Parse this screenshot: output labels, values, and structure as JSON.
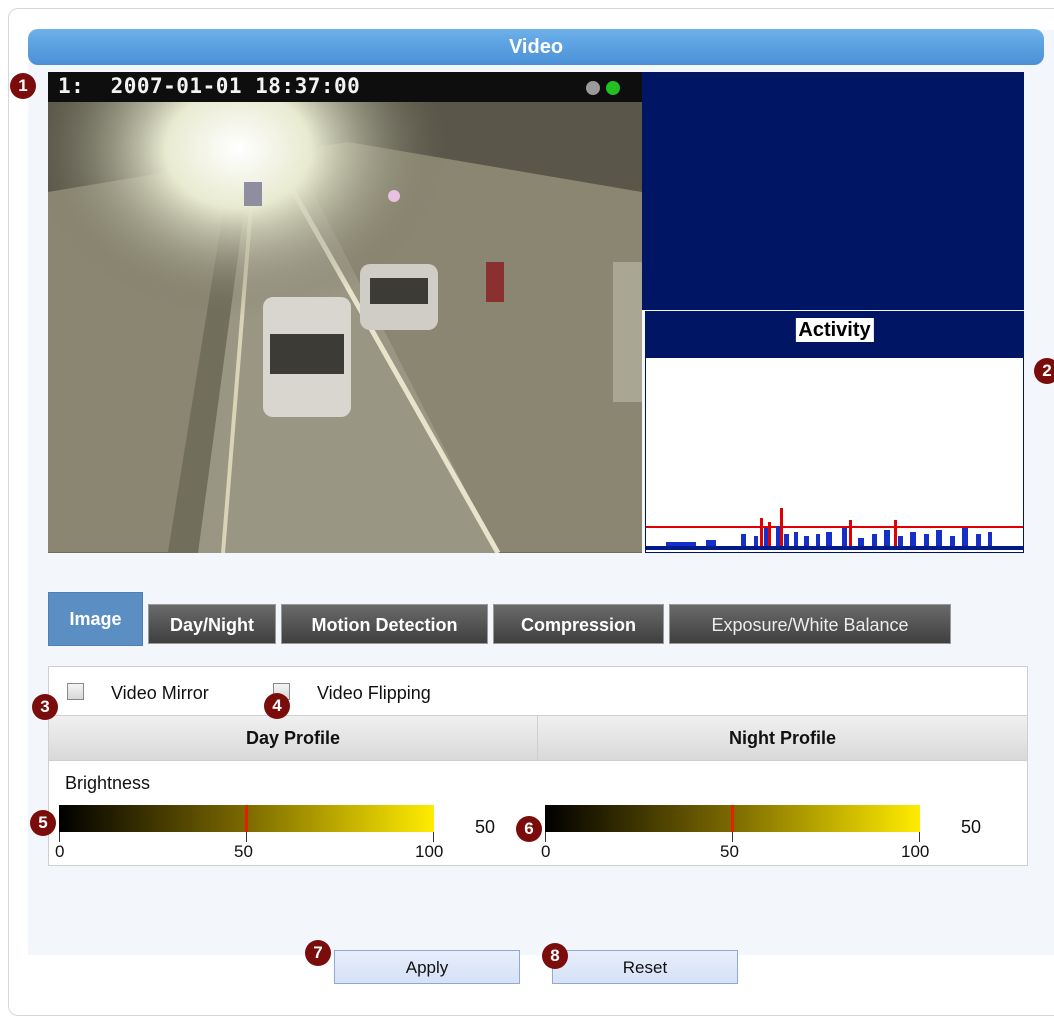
{
  "window": {
    "title": "Video"
  },
  "video": {
    "osd_text": "1:  2007-01-01 18:37:00",
    "indicator_colors": [
      "#9a9a9a",
      "#22c022"
    ]
  },
  "activity": {
    "title": "Activity"
  },
  "tabs": [
    {
      "label": "Image",
      "active": true
    },
    {
      "label": "Day/Night",
      "active": false
    },
    {
      "label": "Motion Detection",
      "active": false
    },
    {
      "label": "Compression",
      "active": false
    },
    {
      "label": "Exposure/White Balance",
      "active": false
    }
  ],
  "image_settings": {
    "video_mirror_label": "Video Mirror",
    "video_mirror_checked": false,
    "video_flipping_label": "Video Flipping",
    "video_flipping_checked": false,
    "day_profile_header": "Day Profile",
    "night_profile_header": "Night Profile",
    "brightness_label": "Brightness",
    "day_brightness": {
      "value": "50",
      "tick_min": "0",
      "tick_mid": "50",
      "tick_max": "100"
    },
    "night_brightness": {
      "value": "50",
      "tick_min": "0",
      "tick_mid": "50",
      "tick_max": "100"
    }
  },
  "buttons": {
    "apply_label": "Apply",
    "reset_label": "Reset"
  },
  "callouts": [
    "1",
    "2",
    "3",
    "4",
    "5",
    "6",
    "7",
    "8"
  ],
  "colors": {
    "accent": "#4a90d6",
    "dark_navy": "#001664",
    "slider_marker": "#e02000"
  }
}
